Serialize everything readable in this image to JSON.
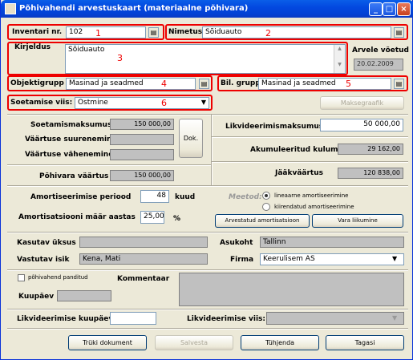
{
  "window": {
    "title": "Põhivahendi arvestuskaart (materiaalne põhivara)",
    "min": "_",
    "max": "□",
    "close": "×"
  },
  "inventari": {
    "label": "Inventari nr.",
    "value": "102",
    "num": "1"
  },
  "nimetus": {
    "label": "Nimetus",
    "value": "Sõiduauto",
    "num": "2"
  },
  "kirjeldus": {
    "label": "Kirjeldus",
    "value": "Sõiduauto",
    "num": "3"
  },
  "arvele": {
    "label": "Arvele võetud",
    "value": "20.02.2009"
  },
  "objektigrupp": {
    "label": "Objektigrupp",
    "value": "Masinad ja seadmed",
    "num": "4"
  },
  "bilgrupp": {
    "label": "Bil. grupp",
    "value": "Masinad ja seadmed",
    "num": "5"
  },
  "soetamise_viis": {
    "label": "Soetamise viis:",
    "value": "Ostmine",
    "num": "6"
  },
  "maksegraafik": "Maksegraafik",
  "soetamismaksumus": {
    "label": "Soetamismaksumus",
    "value": "150 000,00"
  },
  "vaartuse_suurenemine": {
    "label": "Väärtuse suurenemine",
    "value": ""
  },
  "vaartuse_vahenemine": {
    "label": "Väärtuse vähenemine",
    "value": ""
  },
  "dok": "Dok.",
  "pohivara_vaartus": {
    "label": "Põhivara väärtus",
    "value": "150 000,00"
  },
  "likvideerimismaksumus": {
    "label": "Likvideerimismaksumus",
    "value": "50 000,00"
  },
  "akumuleeritud_kulum": {
    "label": "Akumuleeritud kulum",
    "value": "29 162,00"
  },
  "jaakvaartus": {
    "label": "Jääkväärtus",
    "value": "120 838,00"
  },
  "amort_periood": {
    "label": "Amortiseerimise periood",
    "value": "48",
    "unit": "kuud"
  },
  "amort_maar": {
    "label": "Amortisatsiooni määr aastas",
    "value": "25,00",
    "unit": "%"
  },
  "meetod": {
    "label": "Meetod:",
    "opt1": "lineaarne amortiseerimine",
    "opt2": "kiirendatud amortiseerimine"
  },
  "arvestatud_amort": "Arvestatud amortisatsioon",
  "vara_liikumine": "Vara liikumine",
  "kasutav_uksus": {
    "label": "Kasutav üksus",
    "value": ""
  },
  "asukoht": {
    "label": "Asukoht",
    "value": "Tallinn"
  },
  "vastutav_isik": {
    "label": "Vastutav isik",
    "value": "Kena, Mati"
  },
  "firma": {
    "label": "Firma",
    "value": "Keerulisem AS"
  },
  "panditud": "põhivahend panditud",
  "kommentaar": {
    "label": "Kommentaar",
    "value": ""
  },
  "kuupaev": {
    "label": "Kuupäev",
    "value": ""
  },
  "likv_kuupaev": {
    "label": "Likvideerimise kuupäev",
    "value": ""
  },
  "likv_viis": {
    "label": "Likvideerimise viis:",
    "value": ""
  },
  "buttons": {
    "print": "Trüki dokument",
    "save": "Salvesta",
    "clear": "Tühjenda",
    "back": "Tagasi"
  }
}
